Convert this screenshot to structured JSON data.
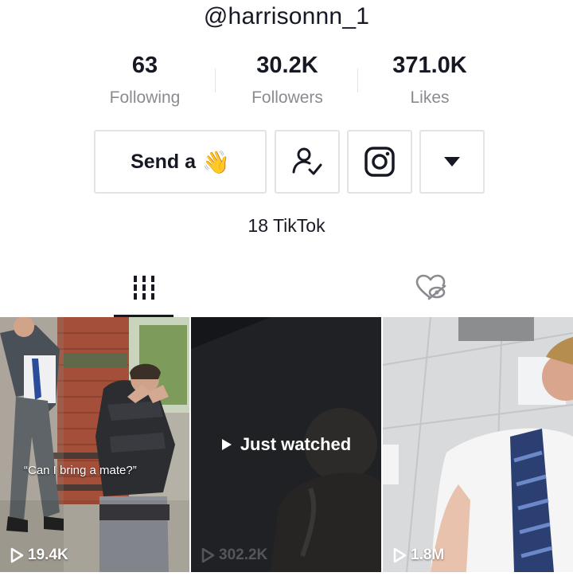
{
  "profile": {
    "username": "@harrisonnn_1",
    "bio": "18 TikTok"
  },
  "stats": [
    {
      "value": "63",
      "label": "Following"
    },
    {
      "value": "30.2K",
      "label": "Followers"
    },
    {
      "value": "371.0K",
      "label": "Likes"
    }
  ],
  "actions": {
    "send_label": "Send a",
    "send_emoji": "👋",
    "follow_icon": "user-check-icon",
    "instagram_icon": "instagram-icon",
    "more_icon": "caret-down-icon"
  },
  "tabs": [
    {
      "icon": "grid-icon",
      "selected": true
    },
    {
      "icon": "hidden-heart-icon",
      "selected": false
    }
  ],
  "videos": [
    {
      "views": "19.4K",
      "caption": "“Can I bring a mate?”"
    },
    {
      "views": "302.2K",
      "overlay": "Just watched"
    },
    {
      "views": "1.8M"
    }
  ],
  "colors": {
    "text": "#161823",
    "muted": "#8a8b91",
    "border": "#e3e3e4"
  }
}
